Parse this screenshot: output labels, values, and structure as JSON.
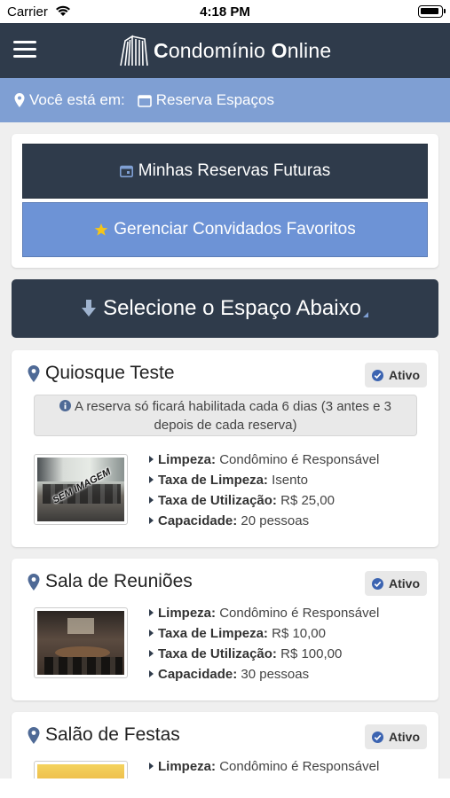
{
  "status_bar": {
    "carrier": "Carrier",
    "time": "4:18 PM"
  },
  "navbar": {
    "brand_first": "C",
    "brand_first_rest": "ondomínio ",
    "brand_second": "O",
    "brand_second_rest": "nline"
  },
  "breadcrumb": {
    "prefix": "Você está em:",
    "current": "Reserva Espaços"
  },
  "actions": {
    "future_reservations": "Minhas Reservas Futuras",
    "favorite_guests": "Gerenciar Convidados Favoritos",
    "select_space": "Selecione o Espaço Abaixo"
  },
  "colors": {
    "navy": "#2f3b4b",
    "accent_blue": "#6d93d6",
    "breadcrumb_blue": "#7f9fd3",
    "star": "#f5c518"
  },
  "thumb_overlay": "SEM IMAGEM",
  "spaces": [
    {
      "name": "Quiosque Teste",
      "status": "Ativo",
      "notice": "A reserva só ficará habilitada cada 6 dias (3 antes e 3 depois de cada reserva)",
      "props": [
        {
          "label": "Limpeza:",
          "value": "Condômino é Responsável"
        },
        {
          "label": "Taxa de Limpeza:",
          "value": "Isento"
        },
        {
          "label": "Taxa de Utilização:",
          "value": "R$ 25,00"
        },
        {
          "label": "Capacidade:",
          "value": "20 pessoas"
        }
      ]
    },
    {
      "name": "Sala de Reuniões",
      "status": "Ativo",
      "props": [
        {
          "label": "Limpeza:",
          "value": "Condômino é Responsável"
        },
        {
          "label": "Taxa de Limpeza:",
          "value": "R$ 10,00"
        },
        {
          "label": "Taxa de Utilização:",
          "value": "R$ 100,00"
        },
        {
          "label": "Capacidade:",
          "value": "30 pessoas"
        }
      ]
    },
    {
      "name": "Salão de Festas",
      "status": "Ativo",
      "props": [
        {
          "label": "Limpeza:",
          "value": "Condômino é Responsável"
        }
      ]
    }
  ]
}
